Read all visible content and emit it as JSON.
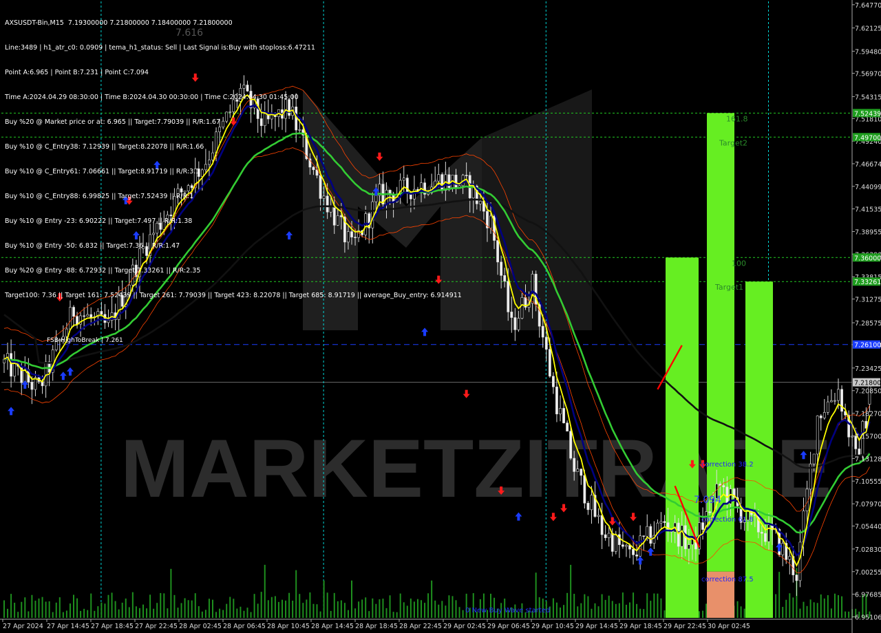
{
  "info_lines": [
    "AXSUSDT-Bin,M15  7.19300000 7.21800000 7.18400000 7.21800000",
    "Line:3489 | h1_atr_c0: 0.0909 | tema_h1_status: Sell | Last Signal is:Buy with stoploss:6.47211",
    "Point A:6.965 | Point B:7.231 | Point C:7.094",
    "Time A:2024.04.29 08:30:00 | Time B:2024.04.30 00:30:00 | Time C:2024.04.30 01:45:00",
    "Buy %20 @ Market price or at: 6.965 || Target:7.79039 || R/R:1.67",
    "Buy %10 @ C_Entry38: 7.12939 || Target:8.22078 || R/R:1.66",
    "Buy %10 @ C_Entry61: 7.06661 || Target:8.91719 || R/R:3.1",
    "Buy %10 @ C_Entry88: 6.99825 || Target:7.52439 || R/R:1",
    "Buy %10 @ Entry -23: 6.90222 || Target:7.497 || R/R:1.38",
    "Buy %10 @ Entry -50: 6.832 || Target:7.36 || R/R:1.47",
    "Buy %20 @ Entry -88: 6.72932 || Target:7.33261 || R/R:2.35",
    "Target100: 7.36 || Target 161: 7.52439 || Target 261: 7.79039 || Target 423: 8.22078 || Target 685: 8.91719 || average_Buy_entry: 6.914911"
  ],
  "watermark": "MARKETZITRADE",
  "price_axis": {
    "ticks": [
      "7.64770",
      "7.62125",
      "7.59480",
      "7.56970",
      "7.54315",
      "7.51810",
      "7.49240",
      "7.46674",
      "7.44099",
      "7.41535",
      "7.38955",
      "7.36390",
      "7.33815",
      "7.31275",
      "7.28575",
      "7.26080",
      "7.23425",
      "7.20850",
      "7.18270",
      "7.15700",
      "7.13128",
      "7.10555",
      "7.07970",
      "7.05440",
      "7.02830",
      "7.00255",
      "6.97685",
      "6.95106"
    ],
    "ylim": [
      6.9499,
      7.6515
    ]
  },
  "time_axis": {
    "ticks": [
      "27 Apr 2024",
      "27 Apr 14:45",
      "27 Apr 18:45",
      "27 Apr 22:45",
      "28 Apr 02:45",
      "28 Apr 06:45",
      "28 Apr 10:45",
      "28 Apr 14:45",
      "28 Apr 18:45",
      "28 Apr 22:45",
      "29 Apr 02:45",
      "29 Apr 06:45",
      "29 Apr 10:45",
      "29 Apr 14:45",
      "29 Apr 18:45",
      "29 Apr 22:45",
      "30 Apr 02:45"
    ]
  },
  "level_tags": [
    {
      "label": "7.52439",
      "price": 7.52439,
      "bg": "#1f9e1f"
    },
    {
      "label": "7.49700",
      "price": 7.497,
      "bg": "#1f9e1f"
    },
    {
      "label": "7.36000",
      "price": 7.36,
      "bg": "#1f9e1f"
    },
    {
      "label": "7.33261",
      "price": 7.33261,
      "bg": "#1f9e1f"
    },
    {
      "label": "7.26100",
      "price": 7.261,
      "bg": "#1a3cff"
    },
    {
      "label": "7.21800",
      "price": 7.218,
      "bg": "#c8c8c8"
    }
  ],
  "chart_labels": {
    "fib_161": "161.8",
    "target2": "Target2",
    "fib_100": "100",
    "target1": "Target1",
    "corr_38": "correction 38.2",
    "corr_61": "correction 61.8",
    "corr_87": "correction 87.5",
    "point_c": "7.094",
    "fsb": "FSB-HighToBreak | 7.261",
    "new_wave": "0 New Buy Wave started",
    "top_label": "7.616"
  },
  "colors": {
    "bull": "#00ff00",
    "bear": "#ff0000",
    "target_green": "#22cc22",
    "fsb_blue": "#1a3cff",
    "ema_black": "#111111",
    "ema_green": "#33cc33",
    "ema_navy": "#000080",
    "ema_yellow": "#ffff00",
    "envelope": "#ff4400",
    "session_cyan": "#00d8d8",
    "target_box": "#66ee22",
    "loss_box": "#e8906a"
  },
  "chart_data": {
    "type": "candlestick",
    "symbol": "AXSUSDT-Bin",
    "timeframe": "M15",
    "ohlc_last": {
      "open": 7.193,
      "high": 7.218,
      "low": 7.184,
      "close": 7.218
    },
    "points": {
      "A": 6.965,
      "B": 7.231,
      "C": 7.094
    },
    "levels": {
      "target_161_8": 7.52439,
      "target2": 7.497,
      "target_100": 7.36,
      "target1": 7.33261,
      "fsb_high_to_break": 7.261,
      "last_price": 7.218
    },
    "ylim": [
      6.9499,
      7.6515
    ],
    "trend_anchors": [
      [
        0,
        7.24
      ],
      [
        10,
        7.21
      ],
      [
        20,
        7.3
      ],
      [
        30,
        7.28
      ],
      [
        40,
        7.37
      ],
      [
        50,
        7.43
      ],
      [
        58,
        7.47
      ],
      [
        68,
        7.55
      ],
      [
        75,
        7.51
      ],
      [
        82,
        7.53
      ],
      [
        92,
        7.43
      ],
      [
        100,
        7.37
      ],
      [
        108,
        7.43
      ],
      [
        118,
        7.44
      ],
      [
        126,
        7.45
      ],
      [
        134,
        7.44
      ],
      [
        140,
        7.4
      ],
      [
        146,
        7.28
      ],
      [
        152,
        7.33
      ],
      [
        158,
        7.21
      ],
      [
        164,
        7.12
      ],
      [
        172,
        7.05
      ],
      [
        180,
        7.02
      ],
      [
        190,
        7.06
      ],
      [
        198,
        7.03
      ],
      [
        206,
        7.1
      ],
      [
        214,
        7.06
      ],
      [
        222,
        7.04
      ],
      [
        228,
        7.0
      ],
      [
        234,
        7.18
      ],
      [
        240,
        7.21
      ],
      [
        245,
        7.13
      ],
      [
        250,
        7.21
      ]
    ]
  }
}
